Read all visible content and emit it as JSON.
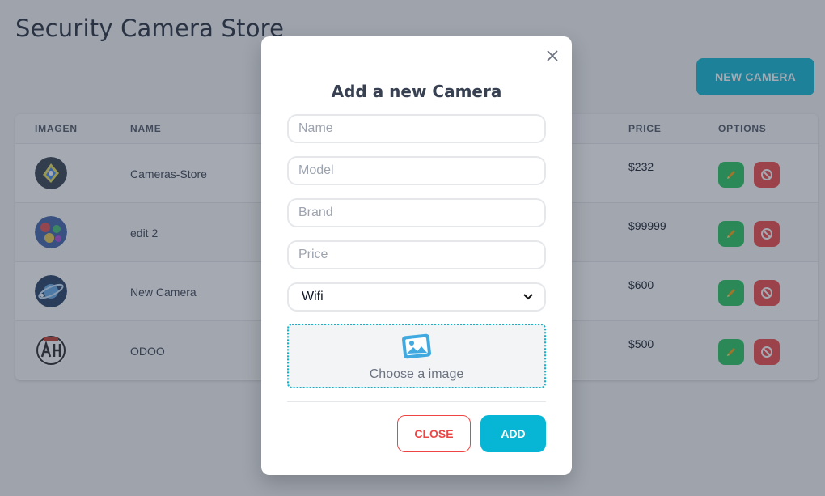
{
  "page": {
    "title": "Security Camera Store",
    "new_camera_label": "NEW CAMERA"
  },
  "table": {
    "headers": {
      "imagen": "IMAGEN",
      "name": "NAME",
      "price": "PRICE",
      "options": "OPTIONS"
    },
    "rows": [
      {
        "name": "Cameras-Store",
        "price": "$232",
        "image_icon": "camera-logo-thumbnail"
      },
      {
        "name": "edit 2",
        "price": "$99999",
        "image_icon": "colorful-illustration-thumbnail"
      },
      {
        "name": "New Camera",
        "price": "$600",
        "image_icon": "planet-illustration-thumbnail"
      },
      {
        "name": "ODOO",
        "price": "$500",
        "image_icon": "comic-logo-thumbnail"
      }
    ],
    "edit_icon": "pencil-icon",
    "delete_icon": "ban-icon"
  },
  "modal": {
    "title": "Add a new Camera",
    "fields": {
      "name_placeholder": "Name",
      "model_placeholder": "Model",
      "brand_placeholder": "Brand",
      "price_placeholder": "Price"
    },
    "select": {
      "value": "Wifi"
    },
    "dropzone": {
      "label": "Choose a image",
      "icon": "image-icon"
    },
    "close_label": "CLOSE",
    "add_label": "ADD"
  },
  "colors": {
    "primary": "#06b6d4",
    "success": "#22c55e",
    "danger": "#ef4444",
    "overlay": "#374151"
  }
}
